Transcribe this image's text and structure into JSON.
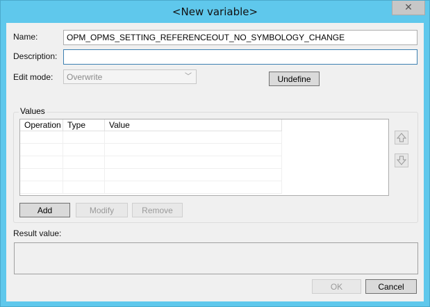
{
  "window": {
    "title": "<New variable>",
    "close_glyph": "✕"
  },
  "form": {
    "name_label": "Name:",
    "name_value": "OPM_OPMS_SETTING_REFERENCEOUT_NO_SYMBOLOGY_CHANGE",
    "description_label": "Description:",
    "description_value": "",
    "edit_mode_label": "Edit mode:",
    "edit_mode_value": "Overwrite",
    "undefine_label": "Undefine"
  },
  "values": {
    "group_label": "Values",
    "columns": [
      "Operation",
      "Type",
      "Value"
    ],
    "rows": [],
    "add_label": "Add",
    "modify_label": "Modify",
    "remove_label": "Remove",
    "up_icon": "arrow-up-icon",
    "down_icon": "arrow-down-icon"
  },
  "result": {
    "label": "Result value:",
    "value": ""
  },
  "footer": {
    "ok_label": "OK",
    "cancel_label": "Cancel"
  }
}
